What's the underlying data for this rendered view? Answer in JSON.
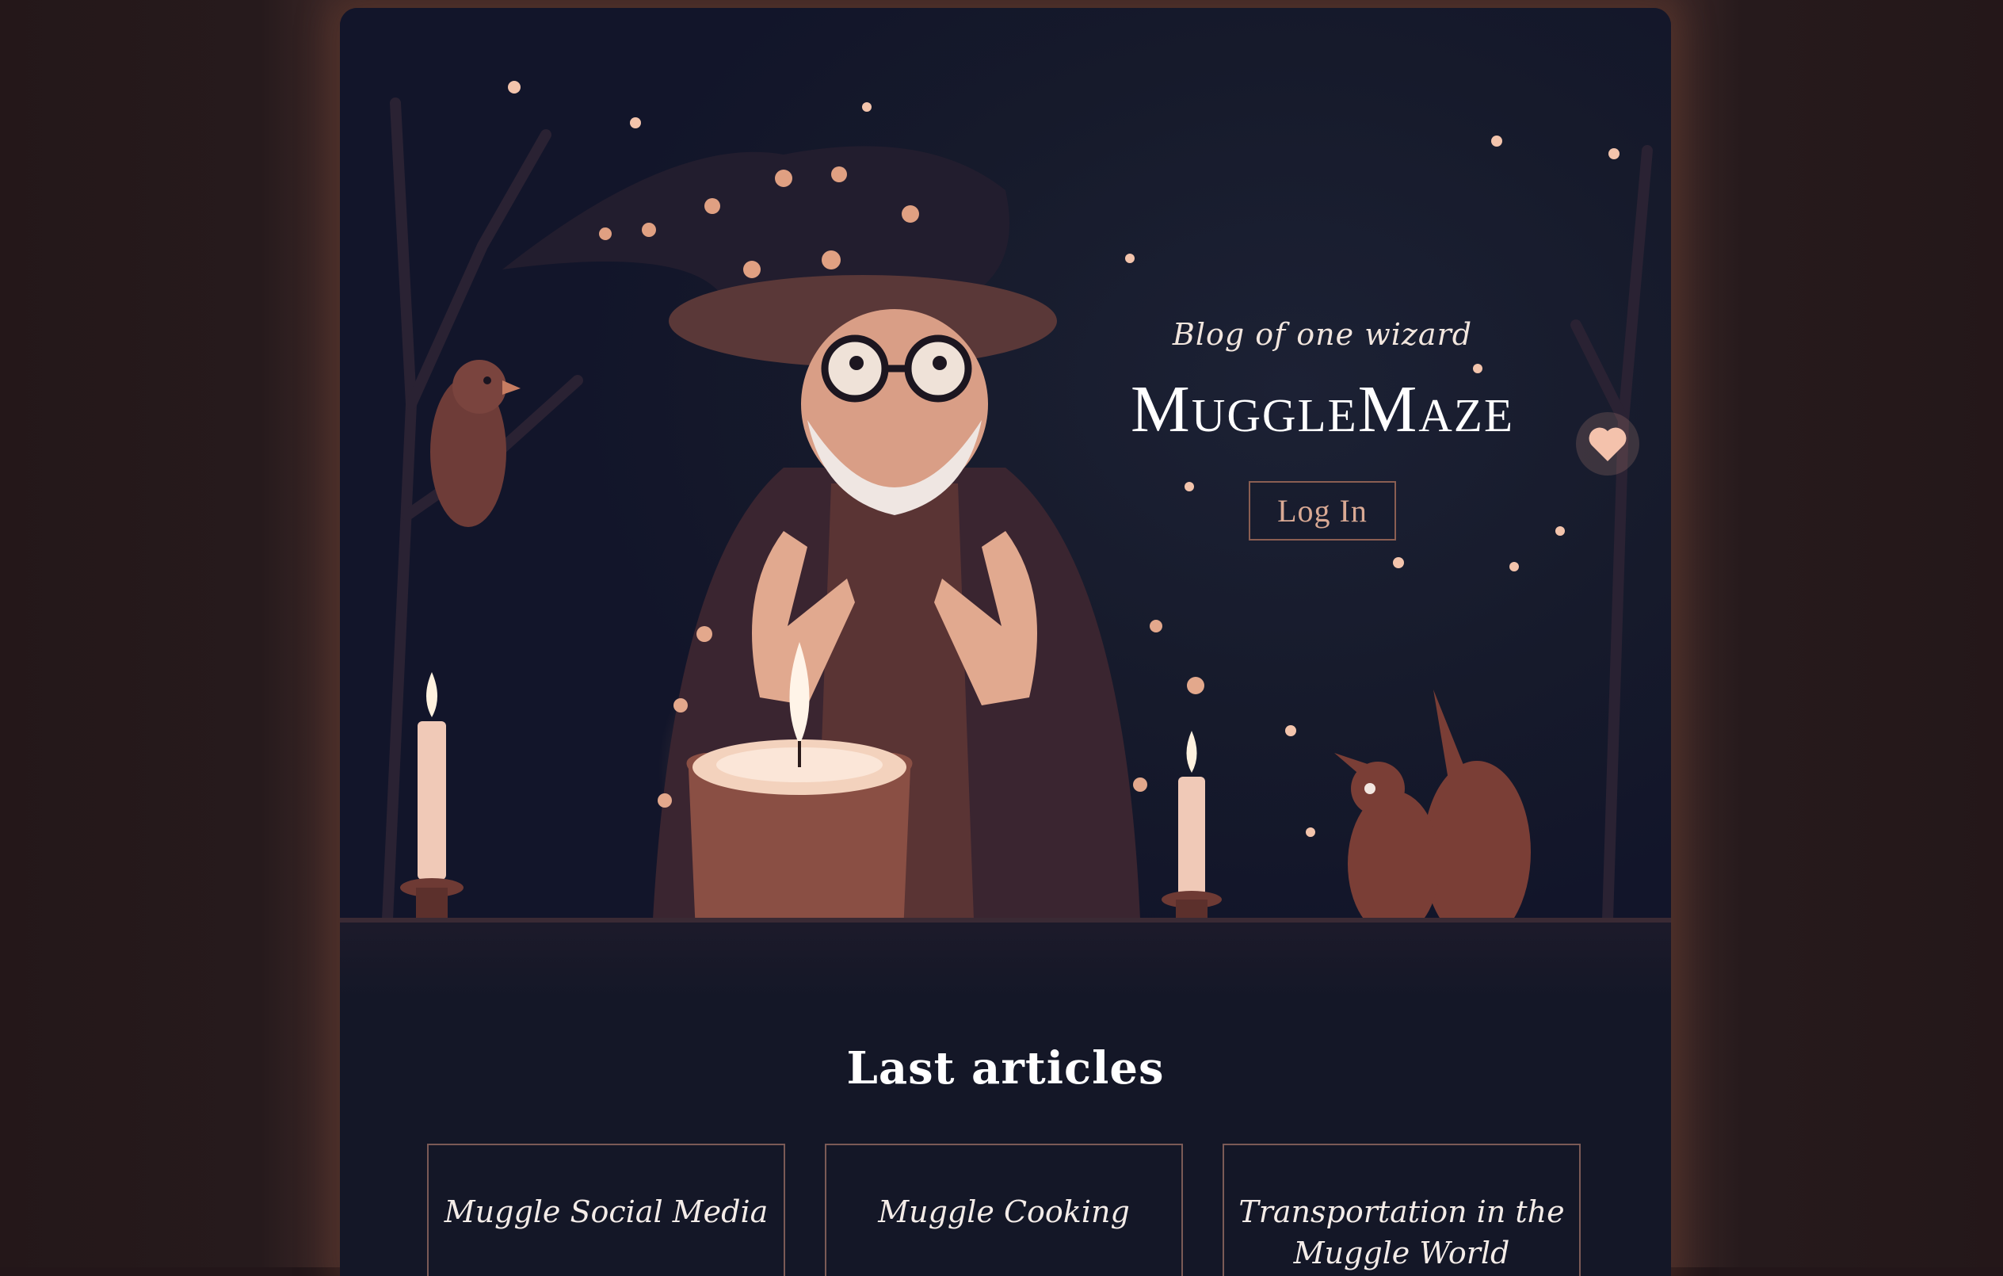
{
  "hero": {
    "tagline": "Blog of one wizard",
    "title": "MuggleMaze",
    "login_label": "Log In",
    "image_alt": "wizard with candle illustration"
  },
  "articles": {
    "heading": "Last articles",
    "items": [
      {
        "title": "Muggle Social Media"
      },
      {
        "title": "Muggle Cooking"
      },
      {
        "title": "Transportation in the Muggle World"
      }
    ]
  },
  "colors": {
    "page_bg": "#231619",
    "frame_bg": "#141727",
    "accent": "#d9a994",
    "border": "#7b5a56"
  }
}
